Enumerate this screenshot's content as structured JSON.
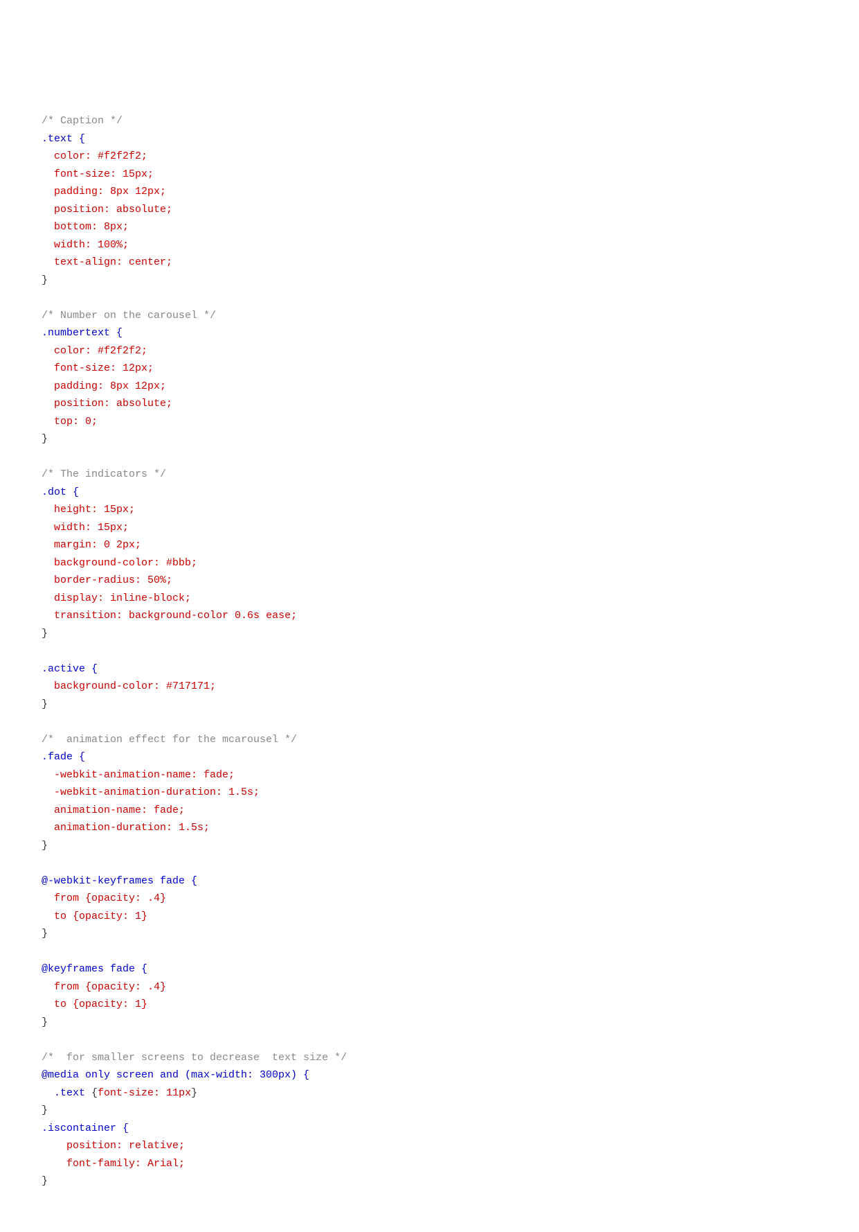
{
  "code": {
    "lines": [
      {
        "type": "empty",
        "text": ""
      },
      {
        "type": "empty",
        "text": ""
      },
      {
        "type": "empty",
        "text": ""
      },
      {
        "type": "comment",
        "text": "/* Caption */"
      },
      {
        "type": "selector",
        "text": ".text {"
      },
      {
        "type": "property-value",
        "property": "  color: ",
        "value": "#f2f2f2;"
      },
      {
        "type": "property-value",
        "property": "  font-size: ",
        "value": "15px;"
      },
      {
        "type": "property-value",
        "property": "  padding: ",
        "value": "8px 12px;"
      },
      {
        "type": "property-value",
        "property": "  position: ",
        "value": "absolute;"
      },
      {
        "type": "property-value",
        "property": "  bottom: ",
        "value": "8px;"
      },
      {
        "type": "property-value",
        "property": "  width: ",
        "value": "100%;"
      },
      {
        "type": "property-value",
        "property": "  text-align: ",
        "value": "center;"
      },
      {
        "type": "punctuation",
        "text": "}"
      },
      {
        "type": "empty",
        "text": ""
      },
      {
        "type": "comment",
        "text": "/* Number on the carousel */"
      },
      {
        "type": "selector",
        "text": ".numbertext {"
      },
      {
        "type": "property-value",
        "property": "  color: ",
        "value": "#f2f2f2;"
      },
      {
        "type": "property-value",
        "property": "  font-size: ",
        "value": "12px;"
      },
      {
        "type": "property-value",
        "property": "  padding: ",
        "value": "8px 12px;"
      },
      {
        "type": "property-value",
        "property": "  position: ",
        "value": "absolute;"
      },
      {
        "type": "property-value",
        "property": "  top: ",
        "value": "0;"
      },
      {
        "type": "punctuation",
        "text": "}"
      },
      {
        "type": "empty",
        "text": ""
      },
      {
        "type": "comment",
        "text": "/* The indicators */"
      },
      {
        "type": "selector",
        "text": ".dot {"
      },
      {
        "type": "property-value",
        "property": "  height: ",
        "value": "15px;"
      },
      {
        "type": "property-value",
        "property": "  width: ",
        "value": "15px;"
      },
      {
        "type": "property-value",
        "property": "  margin: ",
        "value": "0 2px;"
      },
      {
        "type": "property-value",
        "property": "  background-color: ",
        "value": "#bbb;"
      },
      {
        "type": "property-value",
        "property": "  border-radius: ",
        "value": "50%;"
      },
      {
        "type": "property-value",
        "property": "  display: ",
        "value": "inline-block;"
      },
      {
        "type": "property-value",
        "property": "  transition: ",
        "value": "background-color 0.6s ease;"
      },
      {
        "type": "punctuation",
        "text": "}"
      },
      {
        "type": "empty",
        "text": ""
      },
      {
        "type": "selector",
        "text": ".active {"
      },
      {
        "type": "property-value",
        "property": "  background-color: ",
        "value": "#717171;"
      },
      {
        "type": "punctuation",
        "text": "}"
      },
      {
        "type": "empty",
        "text": ""
      },
      {
        "type": "comment",
        "text": "/*  animation effect for the mcarousel */"
      },
      {
        "type": "selector",
        "text": ".fade {"
      },
      {
        "type": "property-value",
        "property": "  -webkit-animation-name: ",
        "value": "fade;"
      },
      {
        "type": "property-value",
        "property": "  -webkit-animation-duration: ",
        "value": "1.5s;"
      },
      {
        "type": "property-value",
        "property": "  animation-name: ",
        "value": "fade;"
      },
      {
        "type": "property-value",
        "property": "  animation-duration: ",
        "value": "1.5s;"
      },
      {
        "type": "punctuation",
        "text": "}"
      },
      {
        "type": "empty",
        "text": ""
      },
      {
        "type": "at-rule",
        "text": "@-webkit-keyframes fade {"
      },
      {
        "type": "property-value",
        "property": "  from ",
        "value": "{opacity: .4}"
      },
      {
        "type": "property-value",
        "property": "  to ",
        "value": "{opacity: 1}"
      },
      {
        "type": "punctuation",
        "text": "}"
      },
      {
        "type": "empty",
        "text": ""
      },
      {
        "type": "at-rule",
        "text": "@keyframes fade {"
      },
      {
        "type": "property-value",
        "property": "  from ",
        "value": "{opacity: .4}"
      },
      {
        "type": "property-value",
        "property": "  to ",
        "value": "{opacity: 1}"
      },
      {
        "type": "punctuation",
        "text": "}"
      },
      {
        "type": "empty",
        "text": ""
      },
      {
        "type": "comment",
        "text": "/*  for smaller screens to decrease  text size */"
      },
      {
        "type": "at-rule",
        "text": "@media only screen and (max-width: 300px) {"
      },
      {
        "type": "mixed",
        "selector": "  .text ",
        "brace": "{",
        "property": "font-size: ",
        "value": "11px",
        "close": "}"
      },
      {
        "type": "punctuation",
        "text": "}"
      },
      {
        "type": "selector",
        "text": ".iscontainer {"
      },
      {
        "type": "property-value",
        "property": "    position: ",
        "value": "relative;"
      },
      {
        "type": "property-value",
        "property": "    font-family: ",
        "value": "Arial;"
      },
      {
        "type": "punctuation",
        "text": "}"
      }
    ]
  }
}
